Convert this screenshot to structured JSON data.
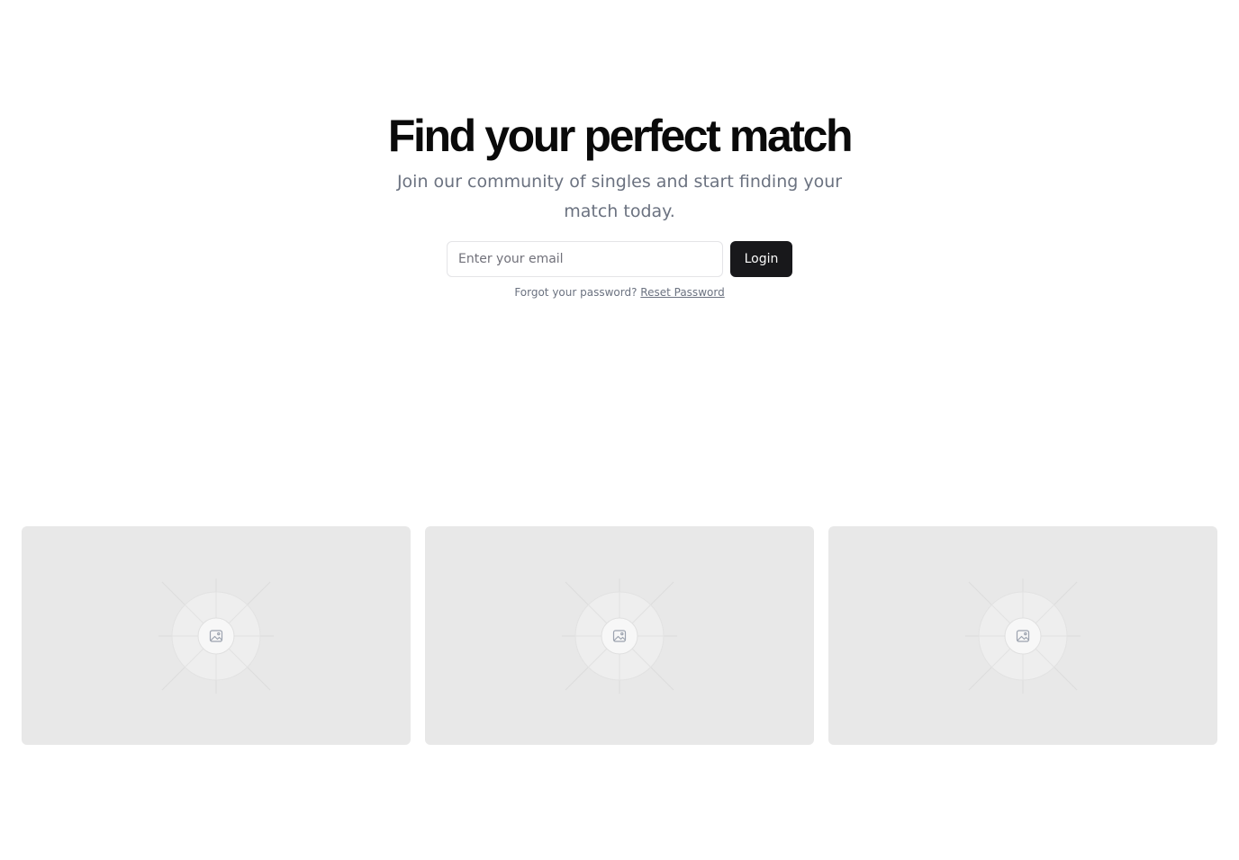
{
  "hero": {
    "title": "Find your perfect match",
    "subtitle": "Join our community of singles and start finding your match today."
  },
  "login": {
    "email_placeholder": "Enter your email",
    "email_value": "",
    "button_label": "Login",
    "forgot_text": "Forgot your password?",
    "reset_link_label": "Reset Password"
  },
  "gallery": {
    "images": [
      {
        "icon": "image-placeholder-icon"
      },
      {
        "icon": "image-placeholder-icon"
      },
      {
        "icon": "image-placeholder-icon"
      }
    ]
  },
  "colors": {
    "primary_button": "#18181b",
    "muted_text": "#6b7280",
    "placeholder_bg": "#e8e8e8"
  }
}
